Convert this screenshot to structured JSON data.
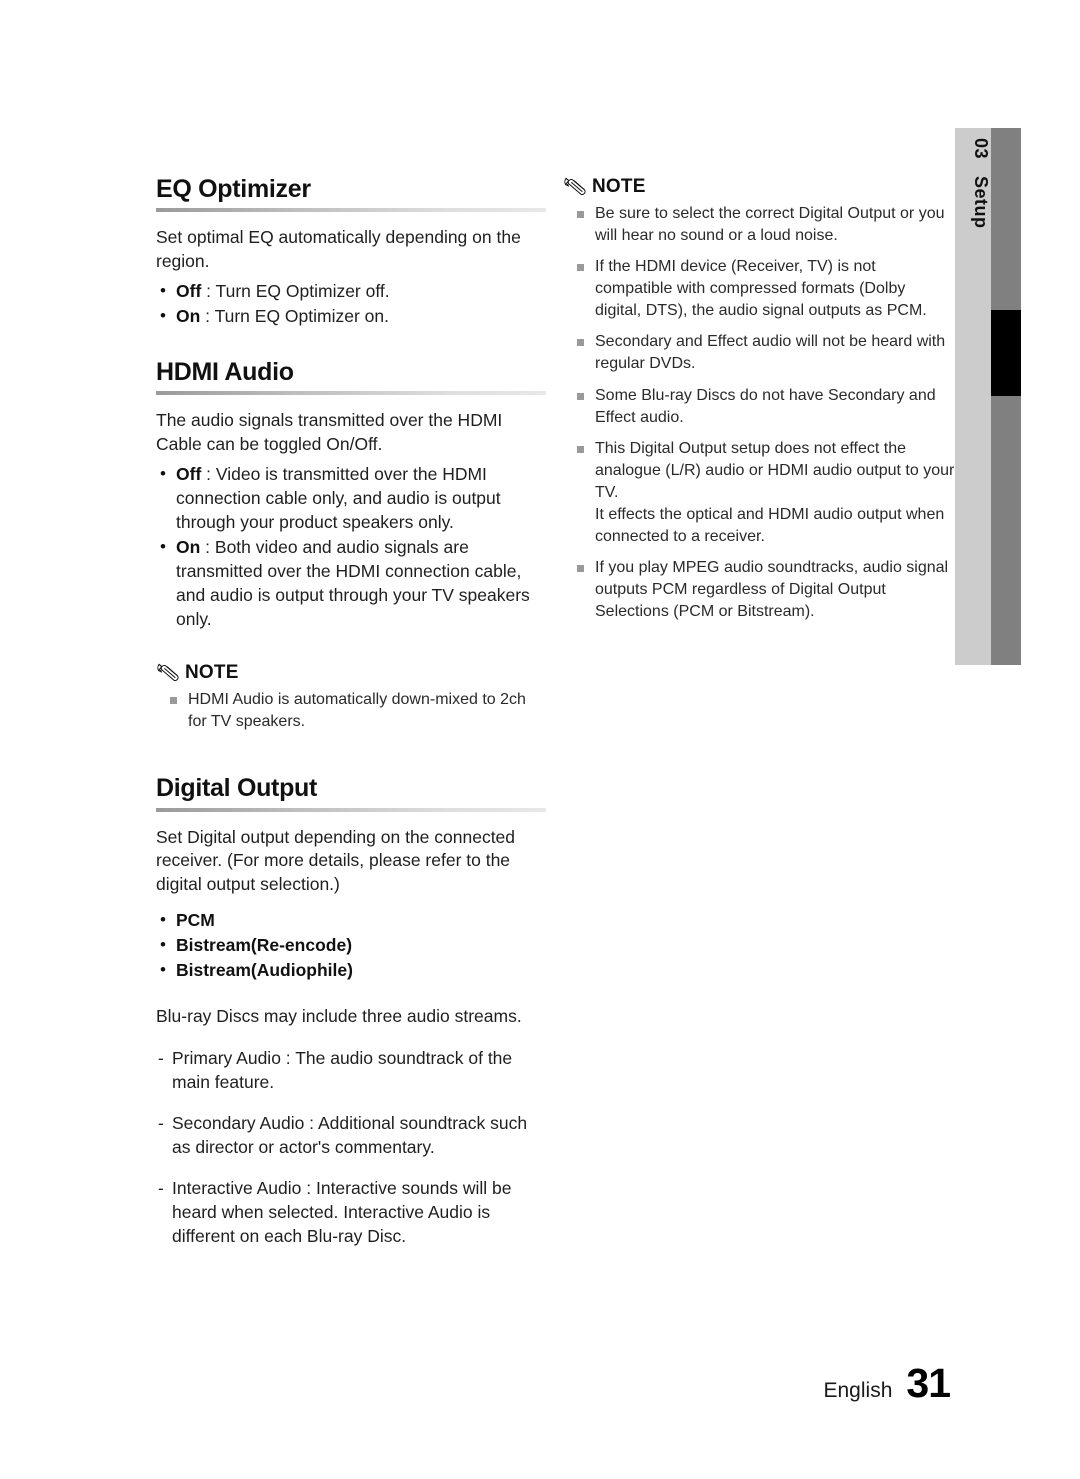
{
  "side_tab": {
    "number": "03",
    "label": "Setup",
    "light_color": "#cccccc",
    "dark_color": "#808080",
    "marker_color": "#000000"
  },
  "left_column": {
    "sections": [
      {
        "heading": "EQ Optimizer",
        "intro": "Set optimal EQ automatically depending on the region.",
        "options": [
          {
            "label": "Off",
            "text": " : Turn EQ Optimizer off."
          },
          {
            "label": "On",
            "text": " : Turn EQ Optimizer on."
          }
        ]
      },
      {
        "heading": "HDMI Audio",
        "intro": "The audio signals transmitted over the HDMI Cable can be toggled On/Off.",
        "options": [
          {
            "label": "Off",
            "text": " : Video is transmitted over the HDMI connection cable only, and audio is output through your product speakers only."
          },
          {
            "label": "On",
            "text": " : Both video and audio signals are transmitted over the HDMI connection cable, and audio is output through your TV speakers only."
          }
        ]
      }
    ],
    "note": {
      "icon": "pencil-icon",
      "title": "NOTE",
      "items": [
        "HDMI Audio is automatically down-mixed to 2ch for TV speakers."
      ]
    },
    "digital_output": {
      "heading": "Digital Output",
      "intro": "Set Digital output depending on the connected receiver. (For more details, please refer to the digital output selection.)",
      "options": [
        "PCM",
        "Bistream(Re-encode)",
        "Bistream(Audiophile)"
      ],
      "streams_intro": "Blu-ray Discs may include three audio streams.",
      "streams": [
        "Primary Audio : The audio soundtrack of the main feature.",
        "Secondary Audio : Additional soundtrack such as director or actor's commentary.",
        "Interactive Audio : Interactive sounds will be heard when selected. Interactive Audio is different on each Blu-ray Disc."
      ]
    }
  },
  "right_column": {
    "note": {
      "icon": "pencil-icon",
      "title": "NOTE",
      "items": [
        {
          "text": "Be sure to select the correct Digital Output or you will hear no sound or a loud noise."
        },
        {
          "text": "If the HDMI device (Receiver, TV) is not compatible with compressed formats (Dolby digital, DTS), the audio signal outputs as PCM."
        },
        {
          "text": "Secondary and Effect audio will not be heard with regular DVDs."
        },
        {
          "text": "Some Blu-ray Discs do not have Secondary and Effect audio."
        },
        {
          "text": "This Digital Output setup does not effect the analogue (L/R) audio or HDMI audio output to your TV.",
          "extra": "It effects the optical and HDMI audio output when connected to a receiver."
        },
        {
          "text": "If you play MPEG audio soundtracks, audio signal outputs PCM regardless of Digital Output Selections (PCM or Bitstream)."
        }
      ]
    }
  },
  "footer": {
    "language": "English",
    "page_number": "31"
  }
}
